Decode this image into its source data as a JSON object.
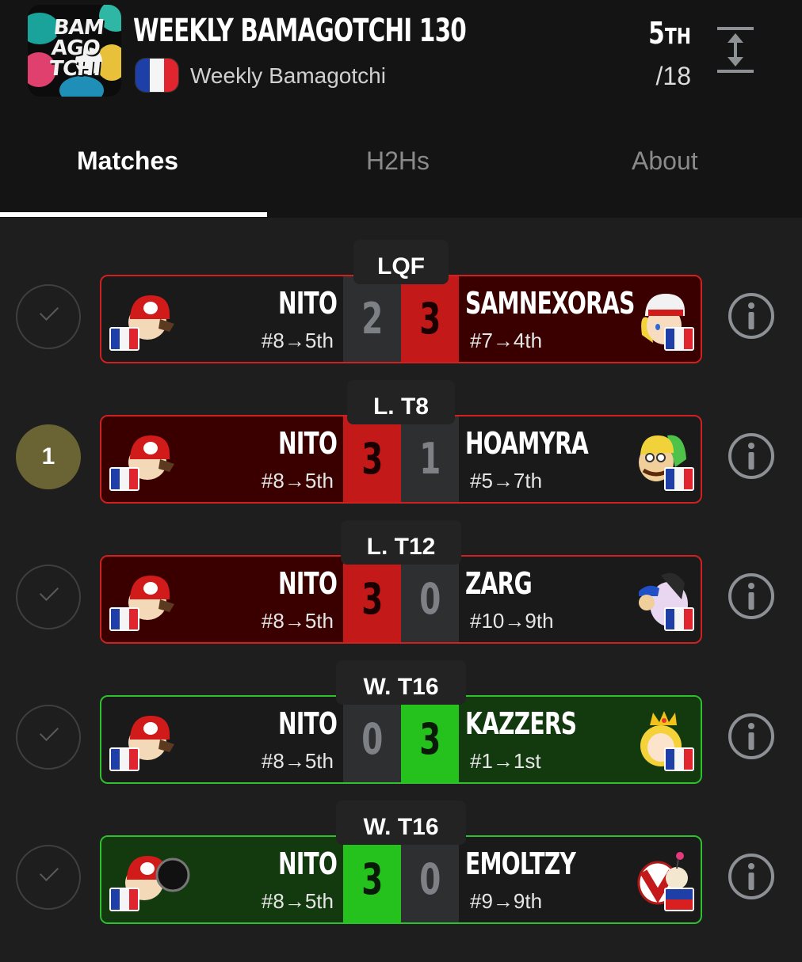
{
  "header": {
    "title": "WEEKLY BAMAGOTCHI 130",
    "subtitle": "Weekly Bamagotchi",
    "logo_text": "BAM AGO TCHI",
    "rank": "5",
    "rank_suffix": "TH",
    "total": "/18"
  },
  "tabs": {
    "matches": "Matches",
    "h2hs": "H2Hs",
    "about": "About"
  },
  "colors": {
    "loss_red": "#c41919",
    "win_green": "#25c11c",
    "badge_gold": "#6a6434"
  },
  "matches": [
    {
      "round": "LQF",
      "status": "check",
      "left": {
        "name": "NITO",
        "seed": "#8→5th",
        "flag": "france"
      },
      "right": {
        "name": "SAMNEXORAS",
        "seed": "#7→4th",
        "flag": "france"
      },
      "left_score": "2",
      "right_score": "3"
    },
    {
      "round": "L. T8",
      "status": "1",
      "left": {
        "name": "NITO",
        "seed": "#8→5th",
        "flag": "france"
      },
      "right": {
        "name": "HOAMYRA",
        "seed": "#5→7th",
        "flag": "france"
      },
      "left_score": "3",
      "right_score": "1"
    },
    {
      "round": "L. T12",
      "status": "check",
      "left": {
        "name": "NITO",
        "seed": "#8→5th",
        "flag": "france"
      },
      "right": {
        "name": "ZARG",
        "seed": "#10→9th",
        "flag": "france"
      },
      "left_score": "3",
      "right_score": "0"
    },
    {
      "round": "W. T16",
      "status": "check",
      "left": {
        "name": "NITO",
        "seed": "#8→5th",
        "flag": "france"
      },
      "right": {
        "name": "KAZZERS",
        "seed": "#1→1st",
        "flag": "france"
      },
      "left_score": "0",
      "right_score": "3"
    },
    {
      "round": "W. T16",
      "status": "check",
      "left": {
        "name": "NITO",
        "seed": "#8→5th",
        "flag": "france"
      },
      "right": {
        "name": "EMOLTZY",
        "seed": "#9→9th",
        "flag": "philippines"
      },
      "left_score": "3",
      "right_score": "0"
    }
  ]
}
